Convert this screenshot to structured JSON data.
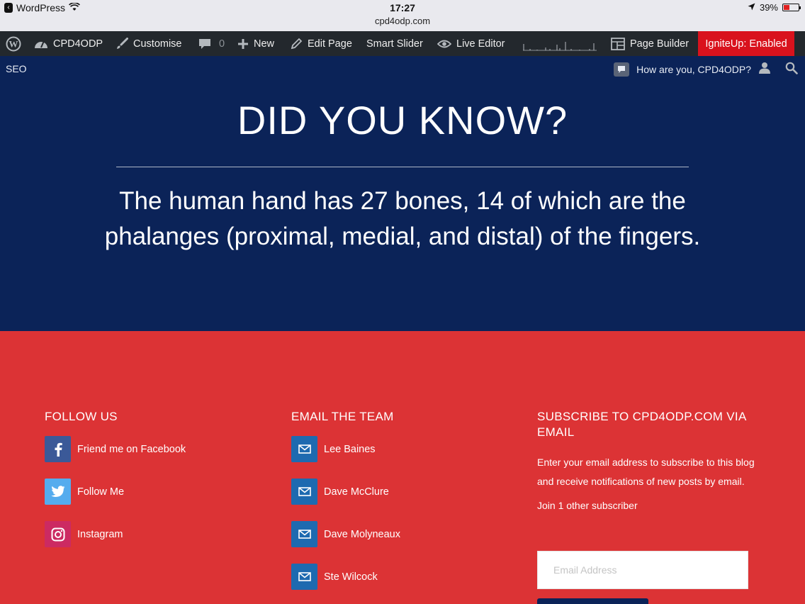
{
  "status_bar": {
    "app_name": "WordPress",
    "time": "17:27",
    "url": "cpd4odp.com",
    "battery": "39%",
    "battery_level": 0.39
  },
  "admin_bar": {
    "site": "CPD4ODP",
    "customise": "Customise",
    "comments_count": "0",
    "new": "New",
    "edit_page": "Edit Page",
    "smart_slider": "Smart Slider",
    "live_editor": "Live Editor",
    "page_builder": "Page Builder",
    "ignite": "IgniteUp: Enabled"
  },
  "secondary_bar": {
    "seo": "SEO",
    "greeting": "How are you, CPD4ODP?"
  },
  "hero": {
    "heading": "DID YOU KNOW?",
    "fact_line1": "The human hand has 27 bones, 14 of which are the",
    "fact_line2": "phalanges (proximal, medial, and distal) of the fingers."
  },
  "footer": {
    "follow": {
      "title": "FOLLOW US",
      "links": [
        "Friend me on Facebook",
        "Follow Me",
        "Instagram"
      ]
    },
    "email_team": {
      "title": "EMAIL THE TEAM",
      "links": [
        "Lee Baines",
        "Dave McClure",
        "Dave Molyneaux",
        "Ste Wilcock"
      ]
    },
    "subscribe": {
      "title_line1": "SUBSCRIBE TO CPD4ODP.COM VIA",
      "title_line2": "EMAIL",
      "description": "Enter your email address to subscribe to this blog and receive notifications of new posts by email.",
      "subscriber_count": "Join 1 other subscriber",
      "email_placeholder": "Email Address"
    }
  },
  "colors": {
    "hero_bg": "#0b2358",
    "footer_bg": "#dc3335",
    "admin_bar_bg": "#23282d",
    "ignite_bg": "#d9121d"
  }
}
